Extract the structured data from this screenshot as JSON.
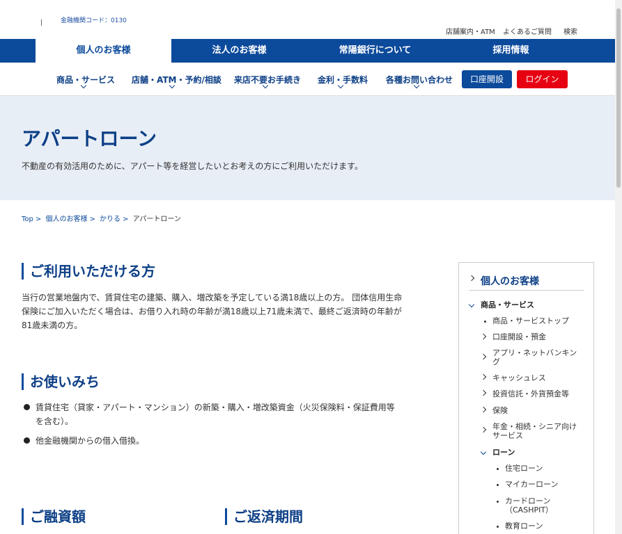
{
  "header": {
    "bank_code": "金融機関コード：0130",
    "utility_links": [
      "店舗案内・ATM",
      "よくあるご質問",
      "検索"
    ]
  },
  "main_nav": [
    "個人のお客様",
    "法人のお客様",
    "常陽銀行について",
    "採用情報"
  ],
  "sub_nav": [
    "商品・サービス",
    "店舗・ATM・予約/相談",
    "来店不要お手続き",
    "金利・手数料",
    "各種お問い合わせ"
  ],
  "buttons": {
    "open_account": "口座開設",
    "login": "ログイン"
  },
  "colors": {
    "brand_blue": "#0c4a9b",
    "login_red": "#e60012",
    "hero_bg": "#e8eef6"
  },
  "hero": {
    "title": "アパートローン",
    "subtitle": "不動産の有効活用のために、アパート等を経営したいとお考えの方にご利用いただけます。"
  },
  "breadcrumb": [
    "Top",
    "個人のお客様",
    "かりる",
    "アパートローン"
  ],
  "sections": {
    "eligibility": {
      "heading": "ご利用いただける方",
      "lines": [
        "当行の営業地盤内で、賃貸住宅の建築、購入、増改築を予定している満18歳以上の方。 団体信用生命",
        "保険にご加入いただく場合は、お借り入れ時の年齢が満18歳以上71歳未満で、最終ご返済時の年齢が",
        "81歳未満の方。"
      ]
    },
    "usage": {
      "heading": "お使いみち",
      "items": [
        [
          "賃貸住宅（貸家・アパート・マンション）の新築・購入・増改築資金（火災保険料・保証費用等",
          "を含む）。"
        ],
        [
          "他金融機関からの借入借換。"
        ]
      ]
    },
    "amount": {
      "heading": "ご融資額"
    },
    "period": {
      "heading": "ご返済期間"
    }
  },
  "sidebar": {
    "title": "個人のお客様",
    "group": "商品・サービス",
    "links": [
      "商品・サービストップ",
      "口座開設・預金",
      "アプリ・ネットバンキング",
      "キャッシュレス",
      "投資信託・外貨預金等",
      "保険",
      "年金・相続・シニア向けサービス"
    ],
    "subgroup": "ローン",
    "sublinks": [
      "住宅ローン",
      "マイカーローン",
      "カードローン（CASHPIT）",
      "教育ローン"
    ]
  }
}
